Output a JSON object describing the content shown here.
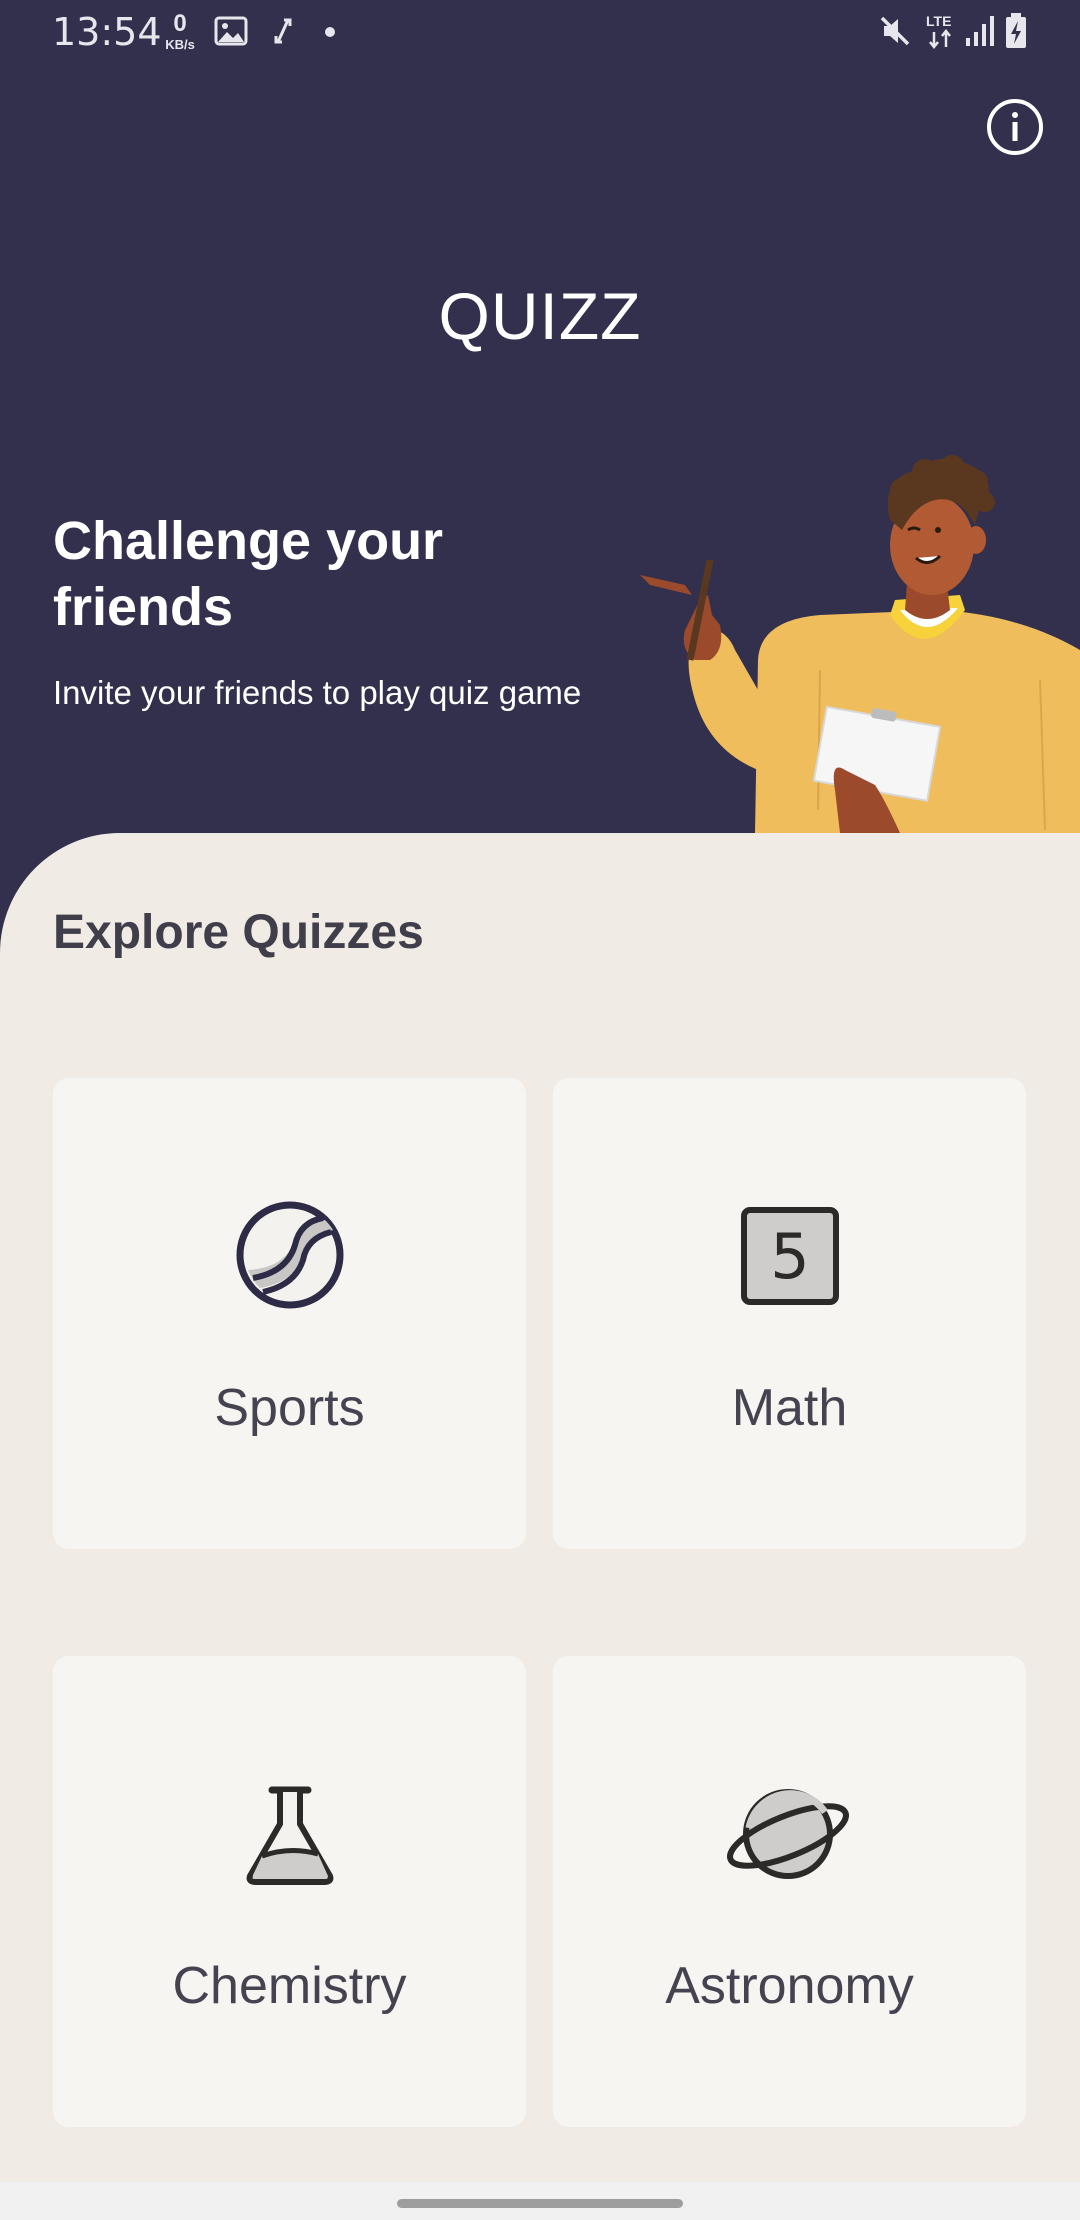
{
  "status_bar": {
    "time": "13:54",
    "net_speed_value": "0",
    "net_speed_unit": "KB/s",
    "icons": [
      "image-icon",
      "sync-icon",
      "dot-icon",
      "mute-icon",
      "lte-icon",
      "signal-icon",
      "battery-charging-icon"
    ]
  },
  "header": {
    "app_title": "QUIZZ",
    "info_icon": "info-icon"
  },
  "hero": {
    "heading": "Challenge your friends",
    "subtitle": "Invite your friends to play quiz game",
    "illustration": "person-pointing-illustration"
  },
  "explore": {
    "title": "Explore Quizzes",
    "categories": [
      {
        "label": "Sports",
        "icon": "tennis-ball-icon"
      },
      {
        "label": "Math",
        "icon": "number-five-icon"
      },
      {
        "label": "Chemistry",
        "icon": "flask-icon"
      },
      {
        "label": "Astronomy",
        "icon": "planet-icon"
      }
    ]
  },
  "colors": {
    "header_bg": "#32304d",
    "sheet_bg": "#f0ebe5",
    "card_bg": "#f7f5f2",
    "text_dark": "#45434f"
  }
}
